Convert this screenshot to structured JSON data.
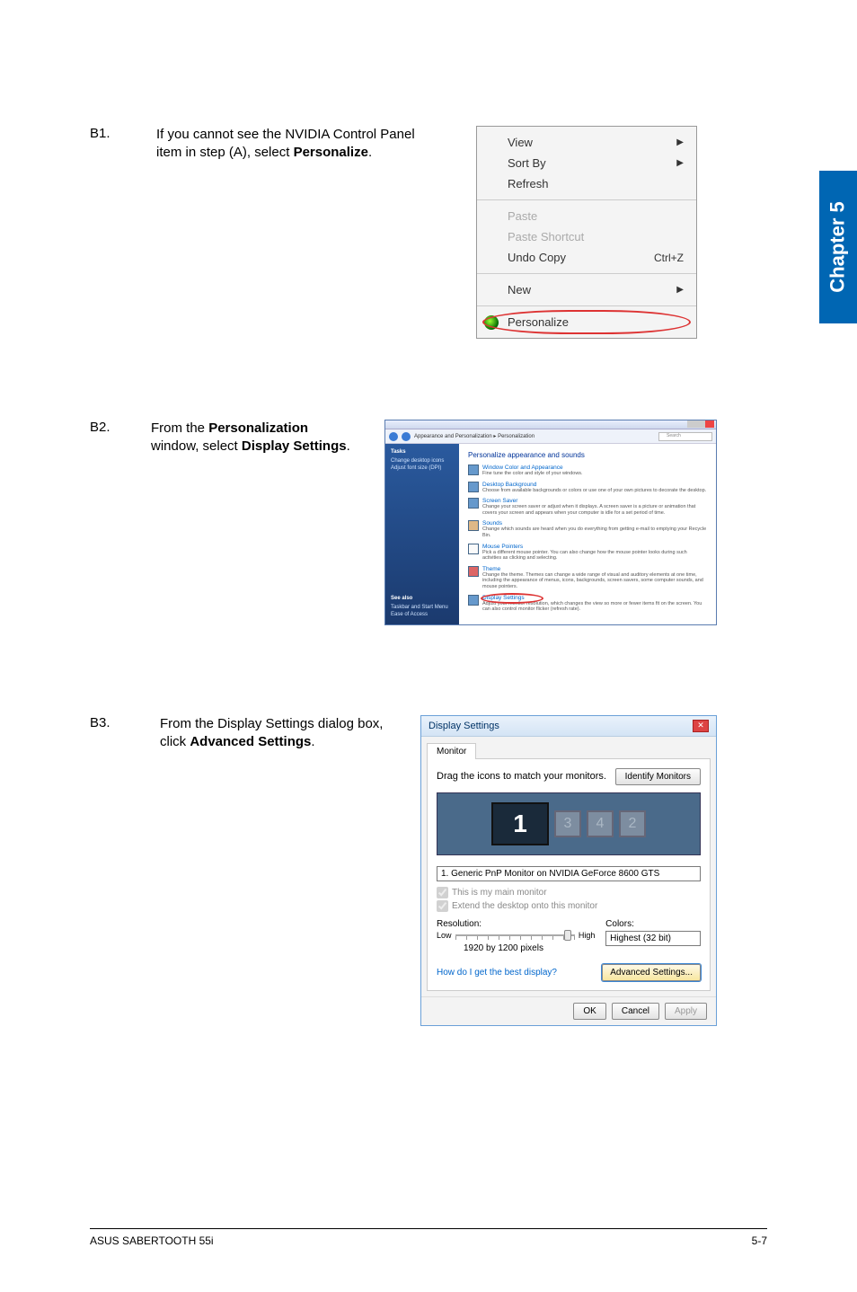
{
  "chapter_tab": "Chapter 5",
  "footer": {
    "left": "ASUS SABERTOOTH 55i",
    "right": "5-7"
  },
  "steps": {
    "b1": {
      "num": "B1.",
      "text_pre": "If you cannot see the NVIDIA Control Panel item in step (A), select ",
      "text_bold": "Personalize",
      "text_post": "."
    },
    "b2": {
      "num": "B2.",
      "text_pre": "From the ",
      "text_bold1": "Personalization",
      "text_mid": " window, select ",
      "text_bold2": "Display Settings",
      "text_post": "."
    },
    "b3": {
      "num": "B3.",
      "text_pre": "From the Display Settings dialog box, click ",
      "text_bold": "Advanced Settings",
      "text_post": "."
    }
  },
  "context_menu": {
    "view": "View",
    "sortby": "Sort By",
    "refresh": "Refresh",
    "paste": "Paste",
    "paste_shortcut": "Paste Shortcut",
    "undo_copy": "Undo Copy",
    "undo_shortcut": "Ctrl+Z",
    "new": "New",
    "personalize": "Personalize"
  },
  "personalization_window": {
    "breadcrumb": "Appearance and Personalization  ▸  Personalization",
    "search_placeholder": "Search",
    "sidebar": {
      "tasks": "Tasks",
      "items": [
        "Change desktop icons",
        "Adjust font size (DPI)"
      ],
      "seealso": "See also",
      "see_items": [
        "Taskbar and Start Menu",
        "Ease of Access"
      ]
    },
    "heading": "Personalize appearance and sounds",
    "links": [
      {
        "title": "Window Color and Appearance",
        "desc": "Fine tune the color and style of your windows."
      },
      {
        "title": "Desktop Background",
        "desc": "Choose from available backgrounds or colors or use one of your own pictures to decorate the desktop."
      },
      {
        "title": "Screen Saver",
        "desc": "Change your screen saver or adjust when it displays. A screen saver is a picture or animation that covers your screen and appears when your computer is idle for a set period of time."
      },
      {
        "title": "Sounds",
        "desc": "Change which sounds are heard when you do everything from getting e-mail to emptying your Recycle Bin."
      },
      {
        "title": "Mouse Pointers",
        "desc": "Pick a different mouse pointer. You can also change how the mouse pointer looks during such activities as clicking and selecting."
      },
      {
        "title": "Theme",
        "desc": "Change the theme. Themes can change a wide range of visual and auditory elements at one time, including the appearance of menus, icons, backgrounds, screen savers, some computer sounds, and mouse pointers."
      },
      {
        "title": "Display Settings",
        "desc": "Adjust your monitor resolution, which changes the view so more or fewer items fit on the screen. You can also control monitor flicker (refresh rate)."
      }
    ]
  },
  "display_settings": {
    "title": "Display Settings",
    "tab": "Monitor",
    "drag_text": "Drag the icons to match your monitors.",
    "identify_btn": "Identify Monitors",
    "monitor_numbers": {
      "main": "1",
      "a": "3",
      "b": "4",
      "c": "2"
    },
    "monitor_select": "1. Generic PnP Monitor on NVIDIA GeForce 8600 GTS",
    "chk_main": "This is my main monitor",
    "chk_extend": "Extend the desktop onto this monitor",
    "resolution_label": "Resolution:",
    "slider_low": "Low",
    "slider_high": "High",
    "resolution_value": "1920 by 1200 pixels",
    "colors_label": "Colors:",
    "colors_value": "Highest (32 bit)",
    "help_link": "How do I get the best display?",
    "advanced_btn": "Advanced Settings...",
    "ok": "OK",
    "cancel": "Cancel",
    "apply": "Apply"
  }
}
